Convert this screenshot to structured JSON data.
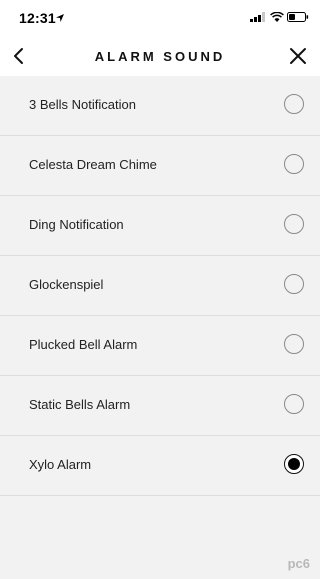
{
  "status_bar": {
    "time": "12:31",
    "icons": [
      "location-arrow-icon",
      "signal-icon",
      "wifi-icon",
      "battery-icon"
    ]
  },
  "nav": {
    "title": "ALARM SOUND",
    "back_icon": "chevron-left-icon",
    "close_icon": "close-icon"
  },
  "sounds": [
    {
      "label": "3 Bells Notification",
      "selected": false
    },
    {
      "label": "Celesta Dream Chime",
      "selected": false
    },
    {
      "label": "Ding Notification",
      "selected": false
    },
    {
      "label": "Glockenspiel",
      "selected": false
    },
    {
      "label": "Plucked Bell Alarm",
      "selected": false
    },
    {
      "label": "Static Bells Alarm",
      "selected": false
    },
    {
      "label": "Xylo Alarm",
      "selected": true
    }
  ],
  "watermark": "pc6"
}
